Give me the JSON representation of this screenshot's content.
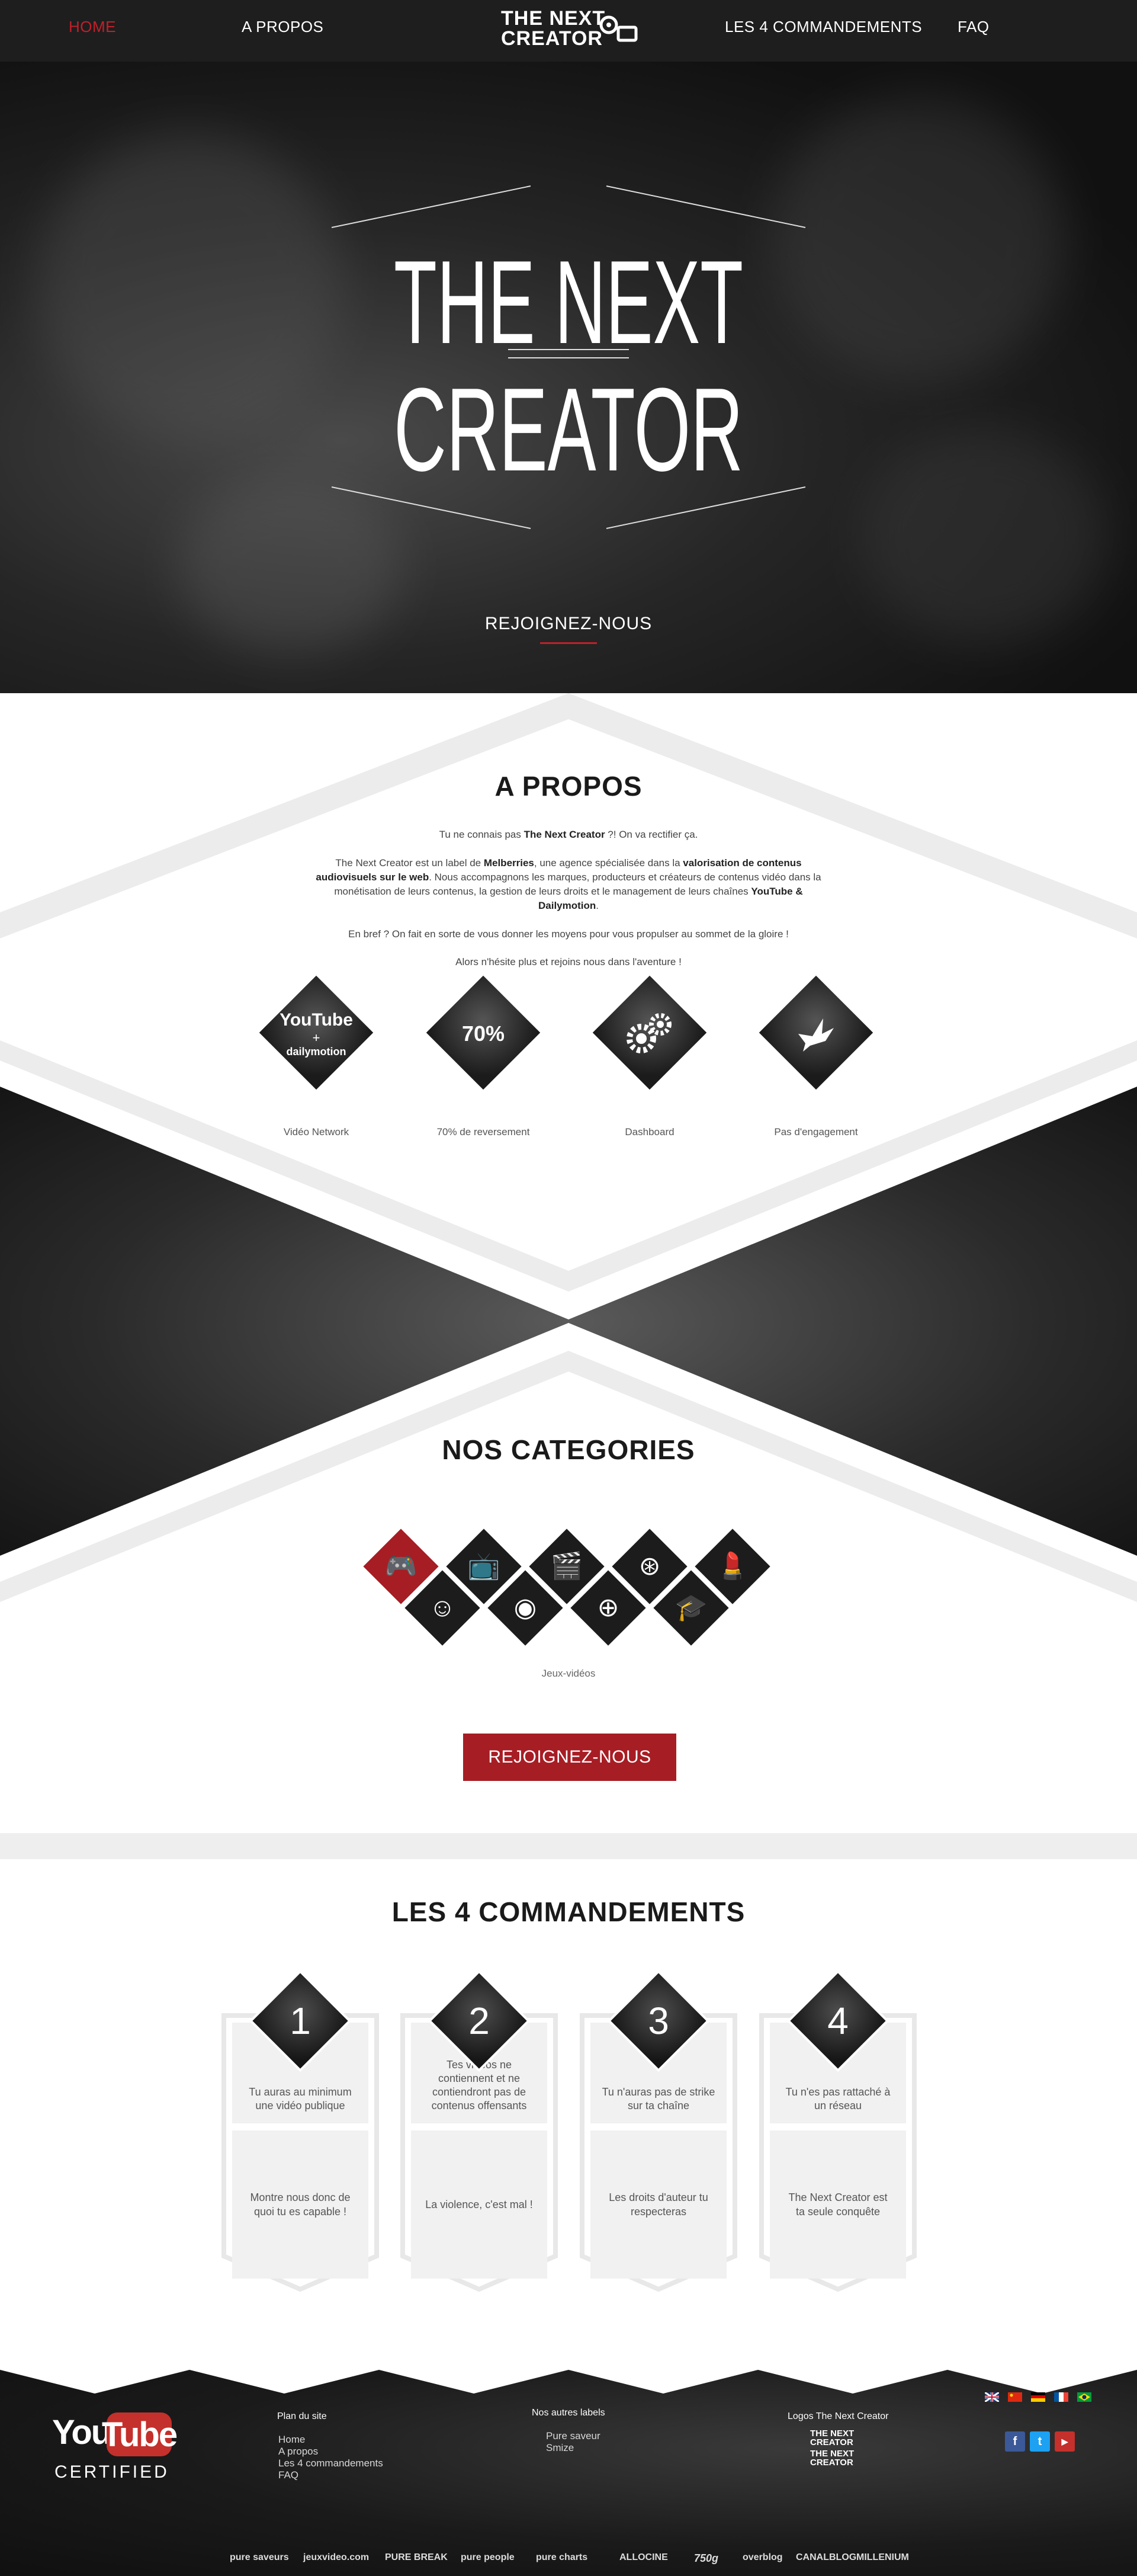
{
  "nav": {
    "home": "HOME",
    "apropos": "A PROPOS",
    "logo_line1": "THE NEXT",
    "logo_line2": "CREATOR",
    "commandements": "LES 4 COMMANDEMENTS",
    "faq": "FAQ",
    "active_color": "#c0202a"
  },
  "hero": {
    "title_line1": "THE NEXT",
    "title_line2": "CREATOR",
    "cta": "REJOIGNEZ-NOUS"
  },
  "apropos": {
    "title": "A PROPOS",
    "p1_pre": "Tu ne connais pas ",
    "p1_bold": "The Next Creator",
    "p1_post": " ?! On va rectifier ça.",
    "p2_a": "The Next Creator est un label de ",
    "p2_b": "Melberries",
    "p2_c": ", une agence spécialisée dans la ",
    "p2_d": "valorisation de contenus audiovisuels sur le web",
    "p2_e": ". Nous accompagnons les marques, producteurs et créateurs de contenus vidéo dans la monétisation de leurs contenus, la gestion de leurs droits et le management de leurs chaînes ",
    "p2_f": "YouTube & Dailymotion",
    "p2_g": ".",
    "p3": "En bref ? On fait en sorte de vous donner les moyens pour vous propulser au sommet de la gloire !",
    "p4": "Alors n'hésite plus et rejoins nous dans l'aventure !",
    "features": [
      {
        "caption": "Vidéo Network",
        "icon": "youtube-dailymotion-icon",
        "text1": "YouTube",
        "text2": "+",
        "text3": "dailymotion"
      },
      {
        "caption": "70% de reversement",
        "icon": "percent-icon",
        "text1": "70%"
      },
      {
        "caption": "Dashboard",
        "icon": "gears-icon"
      },
      {
        "caption": "Pas d'engagement",
        "icon": "dove-icon"
      }
    ]
  },
  "categories": {
    "title": "NOS CATEGORIES",
    "selected_caption": "Jeux-vidéos",
    "cta": "REJOIGNEZ-NOUS",
    "items": [
      {
        "icon": "gamepad-icon",
        "glyph": "🎮"
      },
      {
        "icon": "tv-icon",
        "glyph": "📺"
      },
      {
        "icon": "clapperboard-icon",
        "glyph": "🎬"
      },
      {
        "icon": "film-reel-icon",
        "glyph": "⊛"
      },
      {
        "icon": "lipstick-icon",
        "glyph": "💄"
      },
      {
        "icon": "smiley-icon",
        "glyph": "☺"
      },
      {
        "icon": "music-disc-icon",
        "glyph": "◉"
      },
      {
        "icon": "basketball-icon",
        "glyph": "⊕"
      },
      {
        "icon": "graduation-cap-icon",
        "glyph": "🎓"
      }
    ]
  },
  "commandements": {
    "title": "LES 4 COMMANDEMENTS",
    "items": [
      {
        "num": "1",
        "top": "Tu auras au minimum une vidéo publique",
        "bottom": "Montre nous donc de quoi tu es capable !"
      },
      {
        "num": "2",
        "top": "Tes vidéos ne contiennent et ne contiendront pas de contenus offensants",
        "bottom": "La violence, c'est mal !"
      },
      {
        "num": "3",
        "top": "Tu n'auras pas de strike sur ta chaîne",
        "bottom": "Les droits d'auteur tu respecteras"
      },
      {
        "num": "4",
        "top": "Tu n'es pas rattaché à un réseau",
        "bottom": "The Next Creator est ta seule conquête"
      }
    ]
  },
  "footer": {
    "yt_you": "You",
    "yt_tube": "Tube",
    "yt_certified": "CERTIFIED",
    "plan_title": "Plan du site",
    "plan_links": [
      "Home",
      "A propos",
      "Les 4 commandements",
      "FAQ"
    ],
    "labels_title": "Nos autres labels",
    "labels_links": [
      "Pure saveur",
      "Smize"
    ],
    "logos_title": "Logos The Next Creator",
    "logo_line1": "THE NEXT",
    "logo_line2": "CREATOR",
    "social": [
      "f",
      "t",
      "▶"
    ],
    "partners": [
      "pure saveurs",
      "jeuxvideo.com",
      "PURE BREAK",
      "pure people",
      "pure charts",
      "ALLOCINE",
      "750g",
      "overblog",
      "CANALBLOG",
      "MILLENIUM"
    ]
  }
}
